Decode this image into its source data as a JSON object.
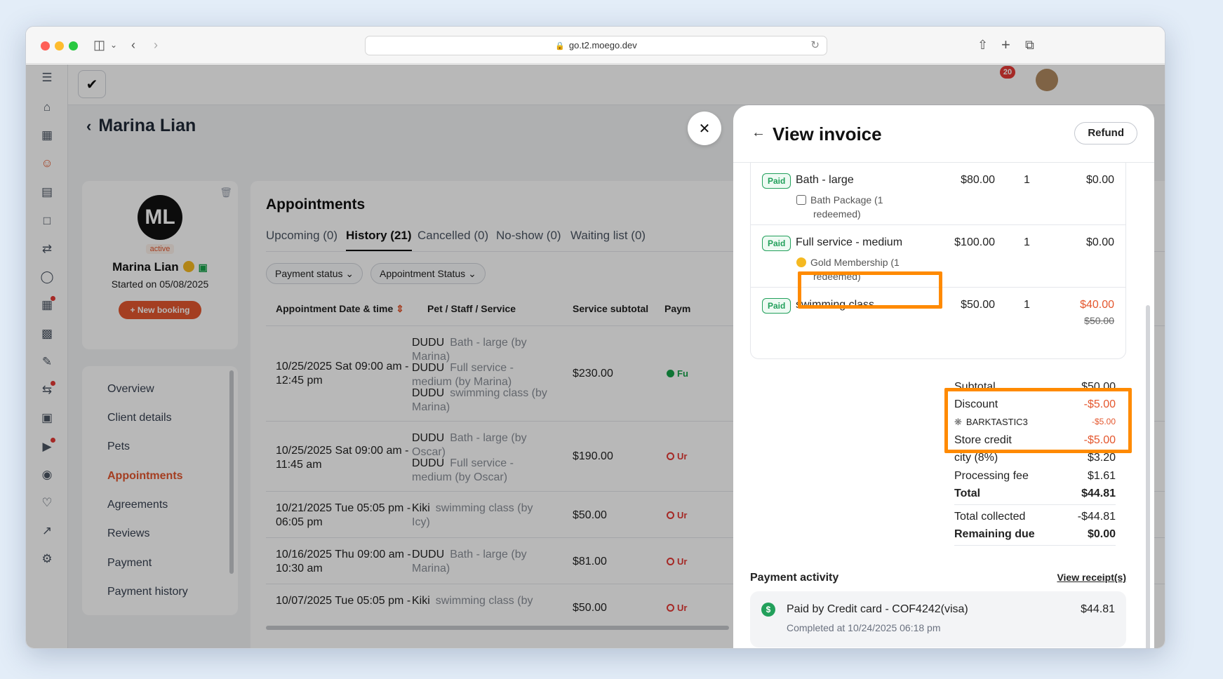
{
  "browser": {
    "url": "go.t2.moego.dev"
  },
  "topbar": {
    "notification_count": "20"
  },
  "client": {
    "name": "Marina Lian",
    "initials": "ML",
    "status": "active",
    "started_on": "Started on 05/08/2025",
    "new_booking_label": "+ New booking"
  },
  "nav": {
    "items": [
      "Overview",
      "Client details",
      "Pets",
      "Appointments",
      "Agreements",
      "Reviews",
      "Payment",
      "Payment history"
    ],
    "active": "Appointments"
  },
  "appointments": {
    "title": "Appointments",
    "tabs": [
      "Upcoming (0)",
      "History (21)",
      "Cancelled (0)",
      "No-show (0)",
      "Waiting list (0)"
    ],
    "filters": [
      "Payment status",
      "Appointment Status"
    ],
    "columns": [
      "Appointment Date & time",
      "Pet / Staff / Service",
      "Service subtotal",
      "Paym"
    ],
    "rows": [
      {
        "datetime": "10/25/2025 Sat 09:00 am - 12:45 pm",
        "services": [
          {
            "pet": "DUDU",
            "desc": "Bath - large (by Marina)"
          },
          {
            "pet": "DUDU",
            "desc": "Full service - medium (by Marina)"
          },
          {
            "pet": "DUDU",
            "desc": "swimming class (by Marina)"
          }
        ],
        "subtotal": "$230.00",
        "payment": "Fu",
        "payment_color": "#16a34a"
      },
      {
        "datetime": "10/25/2025 Sat 09:00 am - 11:45 am",
        "services": [
          {
            "pet": "DUDU",
            "desc": "Bath - large (by Oscar)"
          },
          {
            "pet": "DUDU",
            "desc": "Full service - medium (by Oscar)"
          }
        ],
        "subtotal": "$190.00",
        "payment": "Ur",
        "payment_color": "#e53935"
      },
      {
        "datetime": "10/21/2025 Tue 05:05 pm - 06:05 pm",
        "services": [
          {
            "pet": "Kiki",
            "desc": "swimming class (by Icy)"
          }
        ],
        "subtotal": "$50.00",
        "payment": "Ur",
        "payment_color": "#e53935"
      },
      {
        "datetime": "10/16/2025 Thu 09:00 am - 10:30 am",
        "services": [
          {
            "pet": "DUDU",
            "desc": "Bath - large (by Marina)"
          }
        ],
        "subtotal": "$81.00",
        "payment": "Ur",
        "payment_color": "#e53935"
      },
      {
        "datetime": "10/07/2025 Tue 05:05 pm -",
        "services": [
          {
            "pet": "Kiki",
            "desc": "swimming class (by"
          }
        ],
        "subtotal": "$50.00",
        "payment": "Ur",
        "payment_color": "#e53935"
      }
    ]
  },
  "invoice": {
    "title": "View invoice",
    "refund_label": "Refund",
    "paid_label": "Paid",
    "items": [
      {
        "name": "Bath - large",
        "sub_line1": "Bath Package (1",
        "sub_line2": "redeemed)",
        "price": "$80.00",
        "qty": "1",
        "total": "$0.00"
      },
      {
        "name": "Full service - medium",
        "sub_line1": "Gold Membership (1",
        "sub_line2": "redeemed)",
        "price": "$100.00",
        "qty": "1",
        "total": "$0.00"
      },
      {
        "name": "swimming class",
        "price": "$50.00",
        "qty": "1",
        "total": "$40.00",
        "original_total": "$50.00"
      }
    ],
    "summary": {
      "subtotal_label": "Subtotal",
      "subtotal": "$50.00",
      "discount_label": "Discount",
      "discount": "-$5.00",
      "promo_code": "BARKTASTIC3",
      "promo_amount": "-$5.00",
      "store_credit_label": "Store credit",
      "store_credit": "-$5.00",
      "tax_label": "city (8%)",
      "tax": "$3.20",
      "processing_fee_label": "Processing fee",
      "processing_fee": "$1.61",
      "total_label": "Total",
      "total": "$44.81",
      "total_collected_label": "Total collected",
      "total_collected": "-$44.81",
      "remaining_due_label": "Remaining due",
      "remaining_due": "$0.00"
    },
    "payment_activity": {
      "title": "Payment activity",
      "view_receipts": "View receipt(s)",
      "entry_title": "Paid by Credit card - COF4242(visa)",
      "entry_completed": "Completed at 10/24/2025 06:18 pm",
      "entry_amount": "$44.81"
    }
  },
  "colors": {
    "brand": "#e4572e",
    "highlight": "#ff8a00",
    "paid_green": "#22a05b"
  }
}
